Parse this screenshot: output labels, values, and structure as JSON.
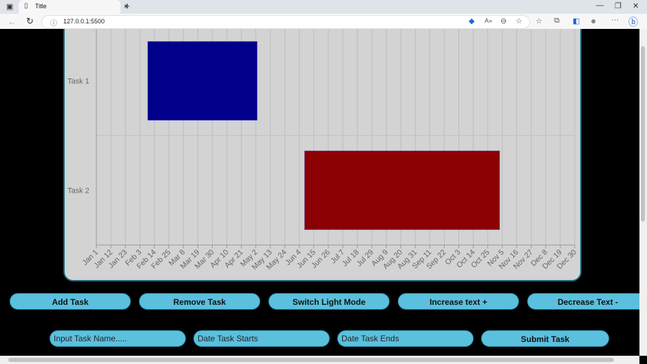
{
  "browser": {
    "tab_title": "Title",
    "url": "127.0.0.1:5500"
  },
  "colors": {
    "task1": "#00008b",
    "task2": "#8b0000",
    "panel_bg": "#d3d3d3",
    "panel_border": "#1d6677",
    "button_bg": "#5bc0de"
  },
  "chart_data": {
    "type": "bar",
    "orientation": "horizontal",
    "subtype": "gantt",
    "categories": [
      "Task 1",
      "Task 2"
    ],
    "tasks": [
      {
        "name": "Task 1",
        "start": "Feb 9",
        "end": "May 3"
      },
      {
        "name": "Task 2",
        "start": "Jun 8",
        "end": "Nov 3"
      }
    ],
    "x_ticks": [
      "Jan 1",
      "Jan 12",
      "Jan 23",
      "Feb 3",
      "Feb 14",
      "Feb 25",
      "Mar 8",
      "Mar 19",
      "Mar 30",
      "Apr 10",
      "Apr 21",
      "May 2",
      "May 13",
      "May 24",
      "Jun 4",
      "Jun 15",
      "Jun 26",
      "Jul 7",
      "Jul 18",
      "Jul 29",
      "Aug 9",
      "Aug 20",
      "Aug 31",
      "Sep 11",
      "Sep 22",
      "Oct 3",
      "Oct 14",
      "Oct 25",
      "Nov 5",
      "Nov 16",
      "Nov 27",
      "Dec 8",
      "Dec 19",
      "Dec 30"
    ],
    "xlim": [
      "Jan 1",
      "Dec 30"
    ],
    "grid": true,
    "xlabel": "",
    "ylabel": "",
    "title": ""
  },
  "buttons": {
    "add_task": "Add Task",
    "remove_task": "Remove Task",
    "switch_mode": "Switch Light Mode",
    "increase_text": "Increase text +",
    "decrease_text": "Decrease Text -",
    "submit_task": "Submit Task"
  },
  "inputs": {
    "task_name_placeholder": "Input Task Name.....",
    "start_placeholder": "Date Task Starts",
    "end_placeholder": "Date Task Ends"
  }
}
